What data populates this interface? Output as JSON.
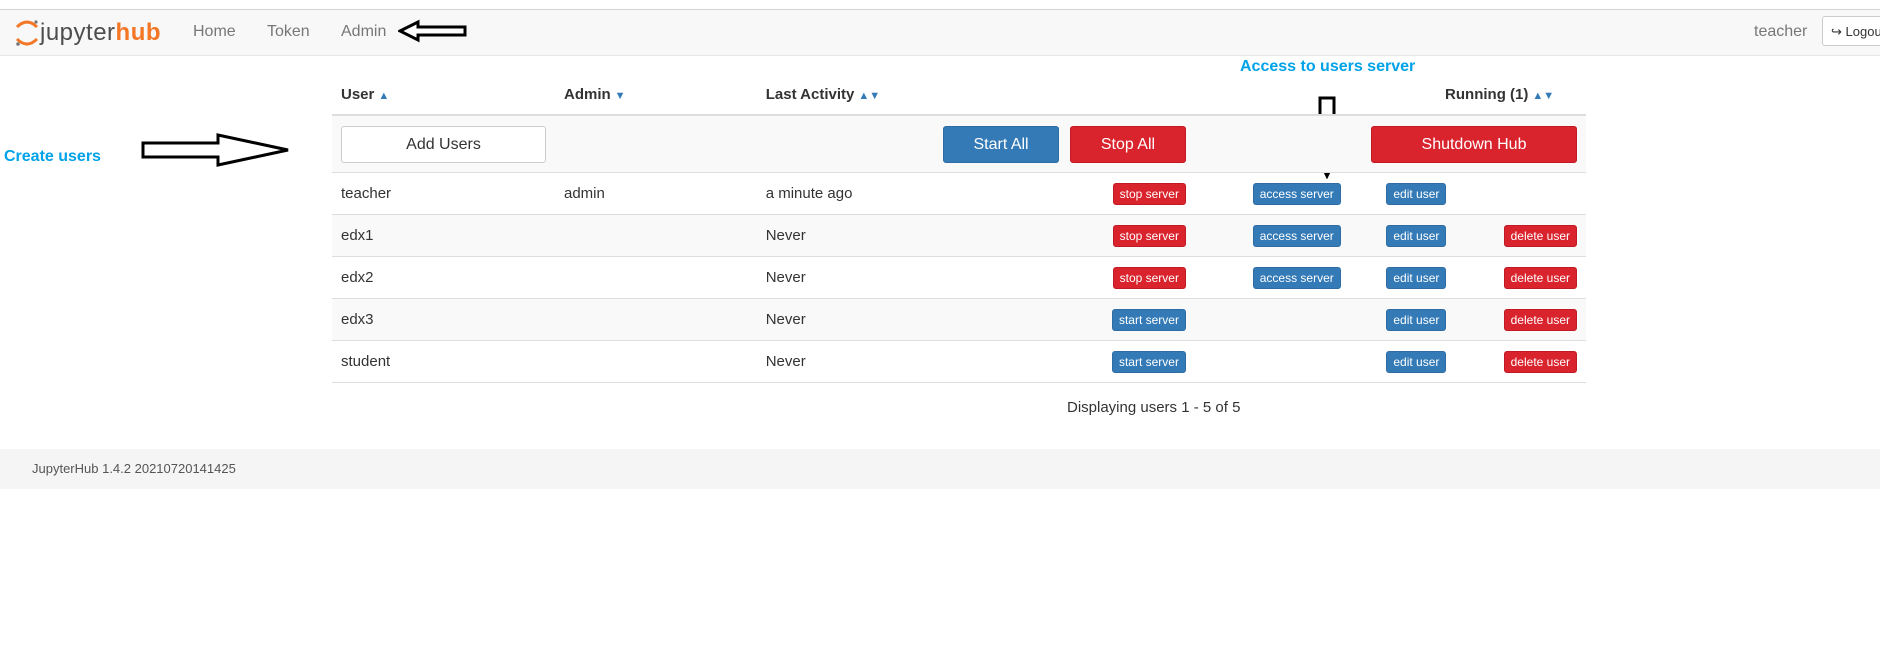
{
  "navbar": {
    "logo_left": "jupyter",
    "logo_right": "hub",
    "links": [
      "Home",
      "Token",
      "Admin"
    ],
    "user": "teacher",
    "logout_label": "Logout",
    "logout_icon": "sign-out-icon"
  },
  "annotations": {
    "create_users": "Create users",
    "access_server": "Access to users server"
  },
  "table": {
    "headers": {
      "user": "User",
      "admin": "Admin",
      "last_activity": "Last Activity",
      "running": "Running (1)"
    },
    "controls": {
      "add_users": "Add Users",
      "start_all": "Start All",
      "stop_all": "Stop All",
      "shutdown_hub": "Shutdown Hub"
    },
    "rows": [
      {
        "name": "teacher",
        "admin": "admin",
        "last_activity": "a minute ago",
        "server_action": "stop server",
        "access": "access server",
        "edit": "edit user",
        "delete": ""
      },
      {
        "name": "edx1",
        "admin": "",
        "last_activity": "Never",
        "server_action": "stop server",
        "access": "access server",
        "edit": "edit user",
        "delete": "delete user"
      },
      {
        "name": "edx2",
        "admin": "",
        "last_activity": "Never",
        "server_action": "stop server",
        "access": "access server",
        "edit": "edit user",
        "delete": "delete user"
      },
      {
        "name": "edx3",
        "admin": "",
        "last_activity": "Never",
        "server_action": "start server",
        "access": "",
        "edit": "edit user",
        "delete": "delete user"
      },
      {
        "name": "student",
        "admin": "",
        "last_activity": "Never",
        "server_action": "start server",
        "access": "",
        "edit": "edit user",
        "delete": "delete user"
      }
    ]
  },
  "pagination": "Displaying users 1 - 5 of 5",
  "footer": "JupyterHub 1.4.2 20210720141425",
  "colors": {
    "primary": "#337ab7",
    "danger": "#d9232d",
    "annotation": "#00a2e8",
    "logo_accent": "#f37726"
  }
}
